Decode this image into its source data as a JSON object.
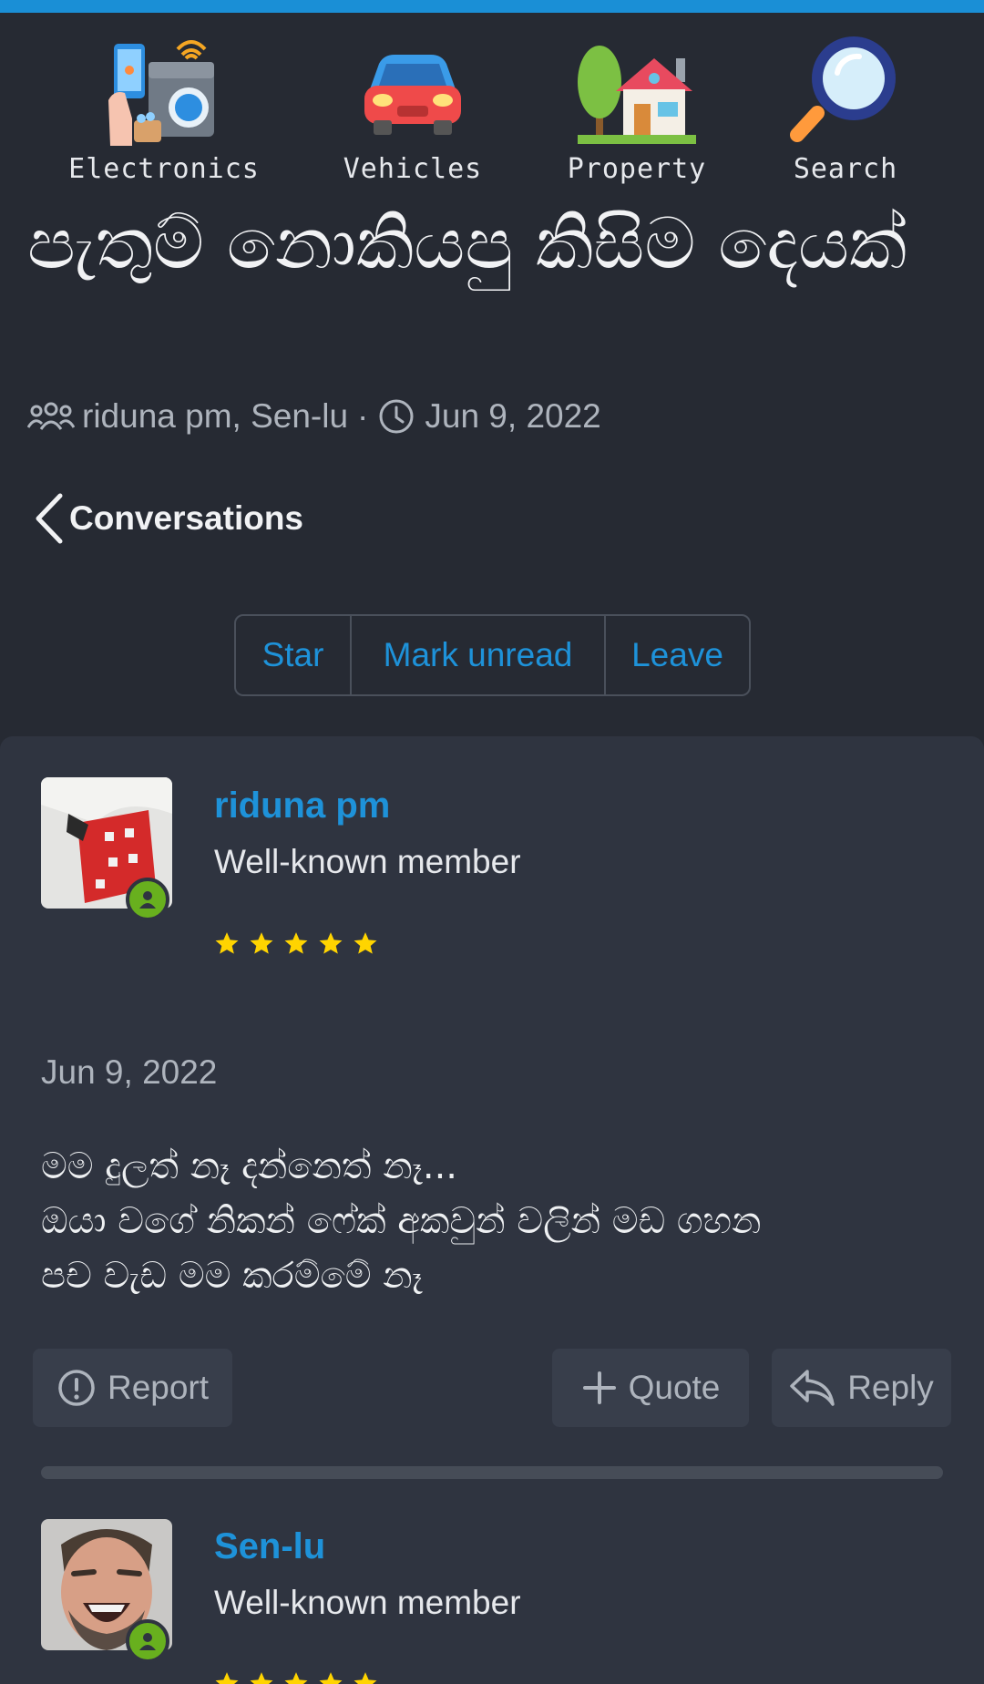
{
  "categories": [
    {
      "label": "Electronics",
      "icon": "electronics-icon"
    },
    {
      "label": "Vehicles",
      "icon": "car-icon"
    },
    {
      "label": "Property",
      "icon": "house-icon"
    },
    {
      "label": "Search",
      "icon": "magnifier-icon"
    }
  ],
  "conversation": {
    "title": "පැතුම් නොකියපු කිසිම දෙයක්",
    "participants": "riduna pm, Sen-lu",
    "separator": "·",
    "date": "Jun 9, 2022"
  },
  "nav": {
    "back_label": "Conversations"
  },
  "actions": {
    "star": "Star",
    "mark_unread": "Mark unread",
    "leave": "Leave"
  },
  "messages": [
    {
      "author": "riduna pm",
      "role": "Well-known member",
      "stars": 5,
      "date": "Jun 9, 2022",
      "body_lines": [
        "මම දුලත් නෑ දන්නෙත් නෑ...",
        "ඔයා වගේ නිකන් ෆේක් අකවුන් වලින් මඩ ගහන",
        "පච වැඩ මම කරම්මේ නෑ"
      ],
      "buttons": {
        "report": "Report",
        "quote": "Quote",
        "reply": "Reply"
      }
    },
    {
      "author": "Sen-lu",
      "role": "Well-known member",
      "stars": 5
    }
  ],
  "colors": {
    "accent": "#1e92d9",
    "online": "#68b01e",
    "star": "#ffd400",
    "background": "#262a33",
    "card": "#2f3440"
  }
}
